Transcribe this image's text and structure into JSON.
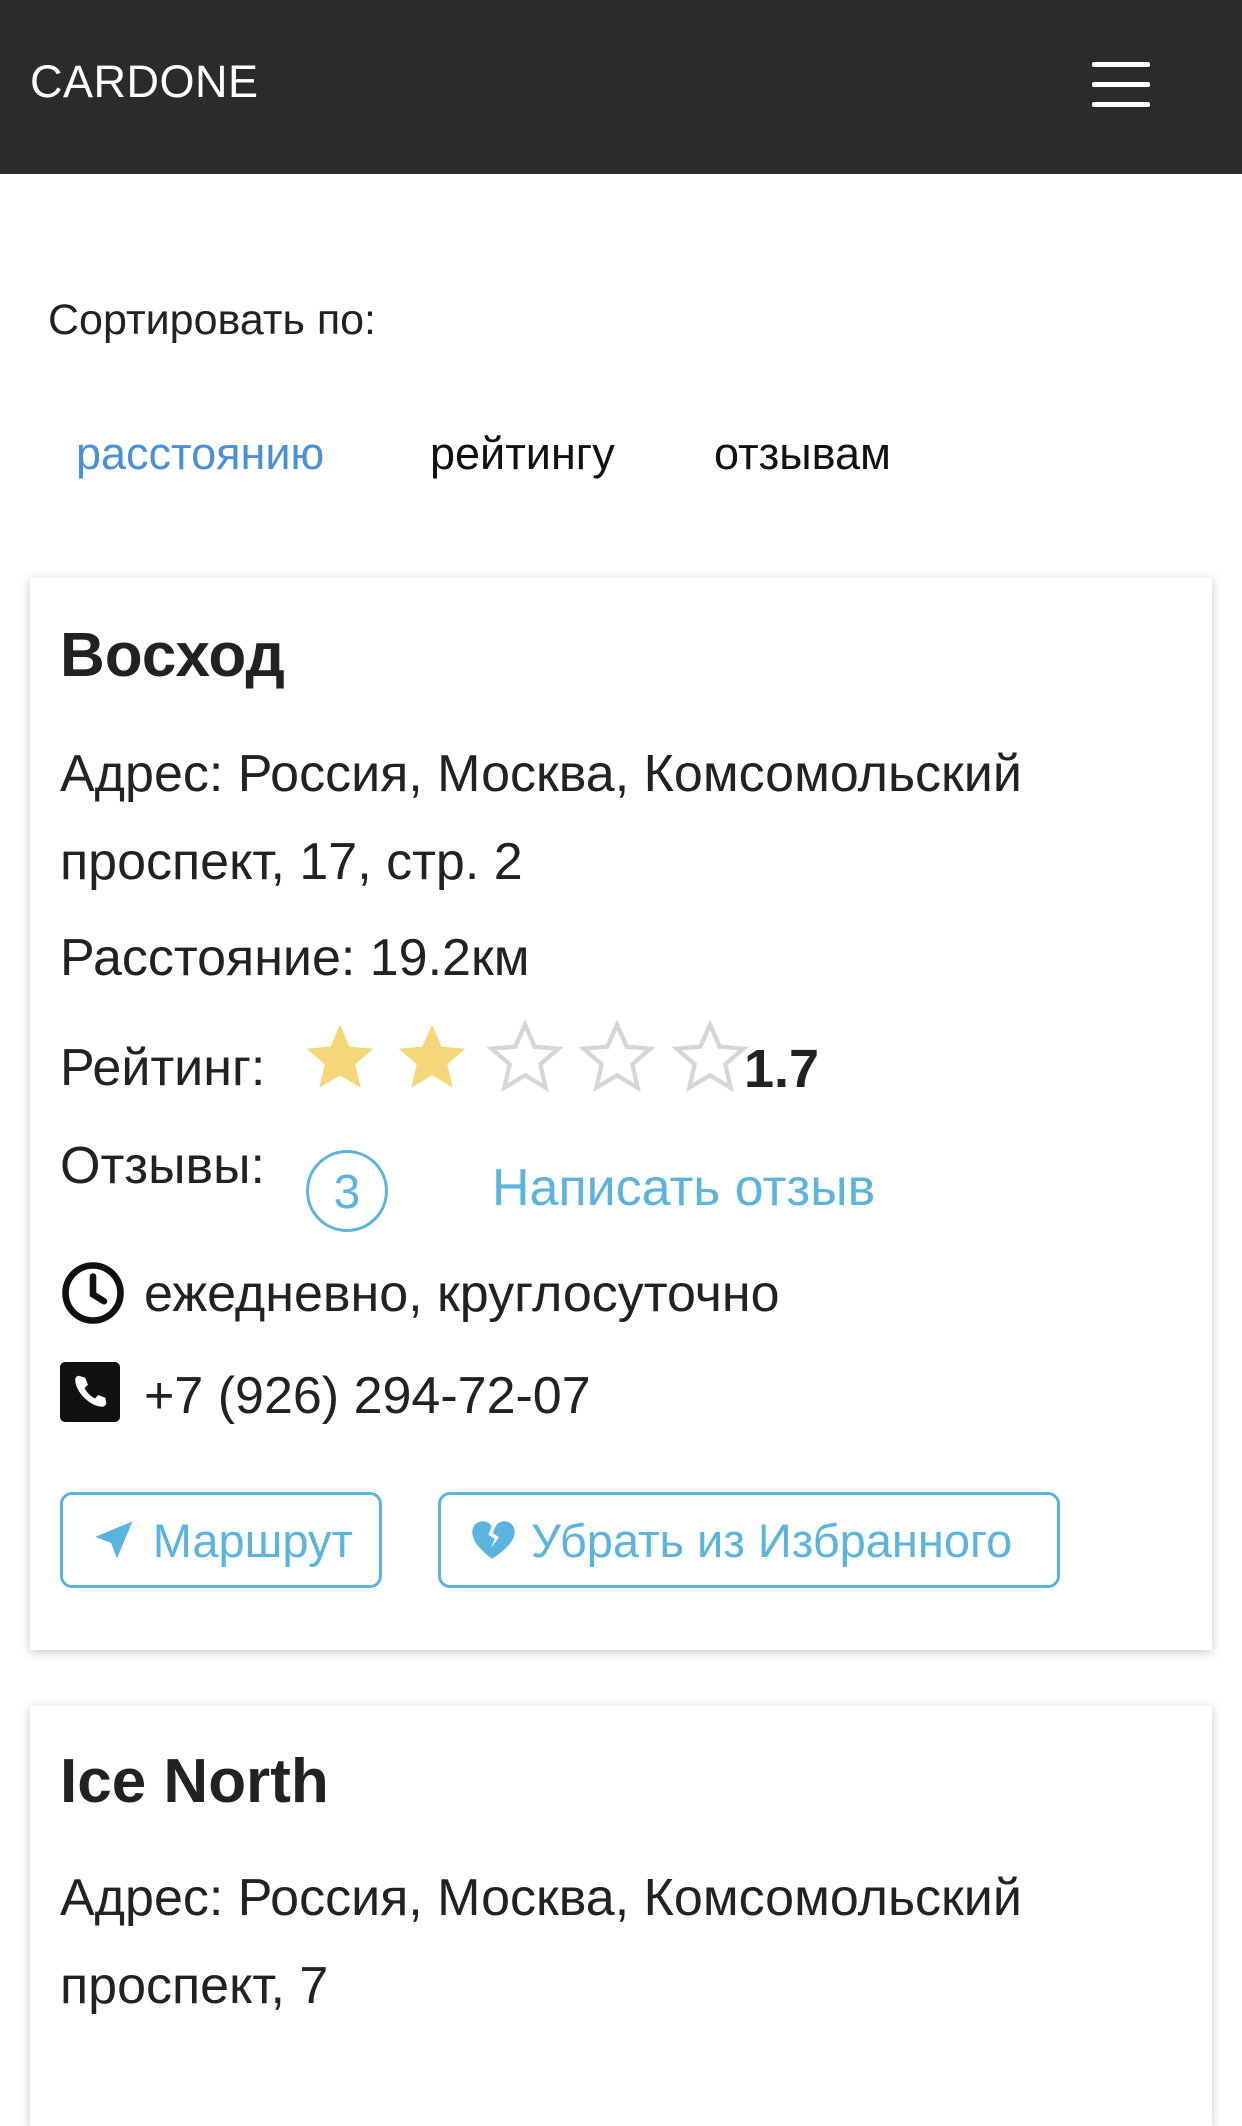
{
  "navbar": {
    "brand": "CARDONE",
    "menu_icon": "hamburger-menu-icon"
  },
  "sort": {
    "label": "Сортировать по:",
    "options": [
      {
        "label": "расстоянию",
        "active": true
      },
      {
        "label": "рейтингу",
        "active": false
      },
      {
        "label": "отзывам",
        "active": false
      }
    ]
  },
  "colors": {
    "navbar": "#2b2b2b",
    "link": "#4a90d9",
    "accent": "#5ab4de",
    "star_filled": "#f5d77a",
    "star_empty": "#d6d6d6"
  },
  "cards": [
    {
      "name": "Восход",
      "address": "Адрес: Россия, Москва, Комсомольский проспект, 17, стр. 2",
      "distance": "Расстояние: 19.2км",
      "rating_label": "Рейтинг:",
      "rating_value": "1.7",
      "stars_filled": 2,
      "stars_total": 5,
      "reviews_label": "Отзывы:",
      "reviews_count": "3",
      "write_review": "Написать отзыв",
      "hours_icon": "clock-icon",
      "hours": "ежедневно, круглосуточно",
      "phone_icon": "phone-icon",
      "phone": "+7 (926) 294-72-07",
      "route_button": {
        "icon": "location-arrow-icon",
        "label": "Маршрут"
      },
      "unfavorite_button": {
        "icon": "broken-heart-icon",
        "label": "Убрать из Избранного"
      }
    },
    {
      "name": "Ice North",
      "address": "Адрес: Россия, Москва, Комсомольский проспект, 7"
    }
  ]
}
